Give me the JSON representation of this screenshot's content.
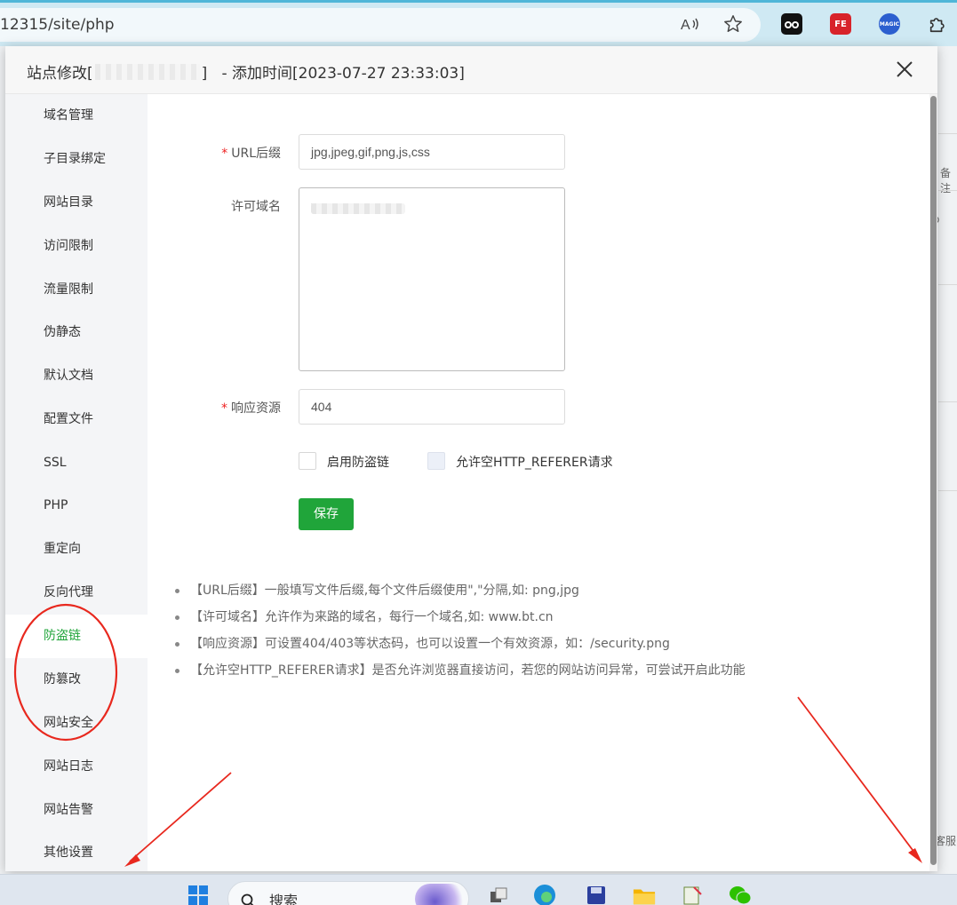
{
  "browser": {
    "url": "12315/site/php",
    "read_aloud_icon": "read-aloud-icon",
    "favorite_icon": "star-icon",
    "extensions": [
      {
        "name": "tampermonkey-icon",
        "label": "",
        "color": "#111111"
      },
      {
        "name": "fe-helper-icon",
        "label": "FE",
        "color": "#d8232a"
      },
      {
        "name": "magic-extension-icon",
        "label": "MAGIC",
        "color": "#2c5fcf"
      },
      {
        "name": "extensions-puzzle-icon",
        "label": "",
        "color": "#333333"
      }
    ]
  },
  "modal": {
    "title_prefix": "站点修改[",
    "title_suffix": "]   - 添加时间[2023-07-27 23:33:03]",
    "close_label": "×"
  },
  "sidebar": {
    "items": [
      {
        "label": "域名管理"
      },
      {
        "label": "子目录绑定"
      },
      {
        "label": "网站目录"
      },
      {
        "label": "访问限制"
      },
      {
        "label": "流量限制"
      },
      {
        "label": "伪静态"
      },
      {
        "label": "默认文档"
      },
      {
        "label": "配置文件"
      },
      {
        "label": "SSL"
      },
      {
        "label": "PHP"
      },
      {
        "label": "重定向"
      },
      {
        "label": "反向代理"
      },
      {
        "label": "防盗链",
        "active": true
      },
      {
        "label": "防篡改"
      },
      {
        "label": "网站安全"
      },
      {
        "label": "网站日志"
      },
      {
        "label": "网站告警"
      },
      {
        "label": "其他设置"
      }
    ],
    "active_color": "#20a53a"
  },
  "form": {
    "url_suffix_label": "URL后缀",
    "url_suffix_value": "jpg,jpeg,gif,png,js,css",
    "allowed_domains_label": "许可域名",
    "allowed_domains_first_char": "w",
    "response_label": "响应资源",
    "response_value": "404",
    "enable_label": "启用防盗链",
    "allow_empty_label": "允许空HTTP_REFERER请求",
    "save_label": "保存",
    "required_mark": "*"
  },
  "tips": [
    "【URL后缀】一般填写文件后缀,每个文件后缀使用\",\"分隔,如: png,jpg",
    "【许可域名】允许作为来路的域名，每行一个域名,如: www.bt.cn",
    "【响应资源】可设置404/403等状态码，也可以设置一个有效资源，如：/security.png",
    "【允许空HTTP_REFERER请求】是否允许浏览器直接访问，若您的网站访问异常，可尝试开启此功能"
  ],
  "background": {
    "right_fragments": [
      "备注",
      "o",
      "客服"
    ]
  },
  "taskbar": {
    "search_label": "搜索"
  },
  "colors": {
    "primary_green": "#20a53a",
    "annotation_red": "#e8281e"
  }
}
